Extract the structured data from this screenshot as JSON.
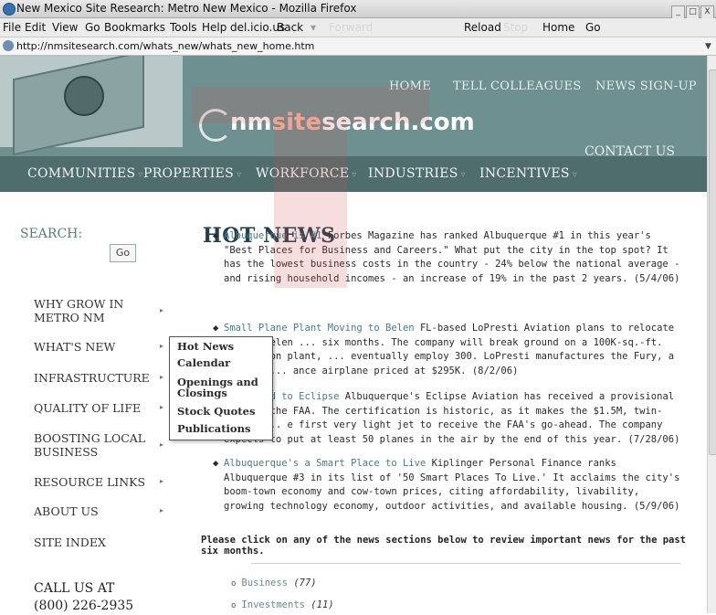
{
  "window": {
    "title": "New Mexico Site Research: Metro New Mexico - Mozilla Firefox",
    "buttons": [
      "_",
      "□",
      "X"
    ]
  },
  "menubar": {
    "items": [
      "File",
      "Edit",
      "View",
      "Go",
      "Bookmarks",
      "Tools",
      "Help",
      "del.icio.us"
    ],
    "back": "Back",
    "forward": "Forward",
    "reload": "Reload",
    "stop": "Stop",
    "home": "Home",
    "go": "Go"
  },
  "address": {
    "url": "http://nmsitesearch.com/whats_new/whats_new_home.htm"
  },
  "header": {
    "top_links": [
      "HOME",
      "TELL COLLEAGUES",
      "NEWS SIGN-UP"
    ],
    "brand_pre": "nm",
    "brand_mid": "site",
    "brand_post": "search.com",
    "contact": "CONTACT US",
    "subnav": [
      "COMMUNITIES",
      "PROPERTIES",
      "WORKFORCE",
      "INDUSTRIES",
      "INCENTIVES"
    ]
  },
  "left": {
    "search_label": "SEARCH:",
    "go_label": "Go",
    "nav": [
      "WHY GROW IN METRO NM",
      "WHAT'S NEW",
      "INFRASTRUCTURE",
      "QUALITY OF LIFE",
      "BOOSTING LOCAL BUSINESS",
      "RESOURCE LINKS",
      "ABOUT US",
      "SITE INDEX"
    ],
    "call_line1": "CALL US AT",
    "call_line2": "(800) 226-2935"
  },
  "dropdown": [
    "Hot News",
    "Calendar",
    "Openings and Closings",
    "Stock Quotes",
    "Publications"
  ],
  "main": {
    "title": "HOT NEWS",
    "news": [
      {
        "head": "Albuquerque is #1",
        "body": " Forbes Magazine has ranked Albuquerque #1 in this year's \"Best Places for Business and Careers.\" What put the city in the top spot? It has the lowest business costs in the country - 24% below the national average - and rising household incomes - an increase of 19% in the past 2 years. (5/4/06)"
      },
      {
        "head": "Small Plane Plant Moving to Belen",
        "body": " FL-based LoPresti Aviation plans to relocate to the Belen ... six months. The company will break ground on a 100K-sq.-ft. production plant, ... eventually employ 300. LoPresti manufactures the Fury, a sporty, ... ance airplane priced at $295K. (8/2/06)"
      },
      {
        "head": "...-Ahead to Eclipse",
        "body": " Albuquerque's Eclipse Aviation has received a provisional ... rom the FAA. The certification is historic, as it makes the $1.5M, twin-engine ... e first very light jet to receive the FAA's go-ahead. The company expects to put at least 50 planes in the air by the end of this year. (7/28/06)"
      },
      {
        "head": "Albuquerque's a Smart Place to Live",
        "body": " Kiplinger Personal Finance ranks Albuquerque #3 in its list of '50 Smart Places To Live.' It acclaims the city's boom-town economy and cow-town prices, citing affordability, livability, growing technology economy, outdoor activities, and available housing. (5/9/06)"
      }
    ],
    "please": "Please click on any of the news sections below to review important news for the past six months.",
    "categories": [
      {
        "name": "Business",
        "count": "(77)"
      },
      {
        "name": "Investments",
        "count": "(11)"
      }
    ]
  },
  "colors": {
    "header": "#6e9090",
    "subnav": "#4f6d6d",
    "accent": "#24404a"
  }
}
